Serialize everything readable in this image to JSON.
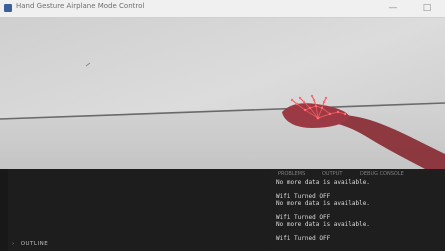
{
  "window": {
    "title": "Hand Gesture Airplane Mode Control",
    "minimize_glyph": "—",
    "maximize_glyph": "□"
  },
  "camera_feed": {
    "hand_landmark_color": "#e8555b",
    "arm_color": "#8a2f38",
    "wall_color": "#d7d7d7"
  },
  "bottom_panel": {
    "tabs": [
      "PROBLEMS",
      "OUTPUT",
      "DEBUG CONSOLE"
    ],
    "outline_label": "OUTLINE",
    "output_lines": [
      "No more data is available.",
      "",
      "Wifi Turned OFF",
      "No more data is available.",
      "",
      "Wifi Turned OFF",
      "No more data is available.",
      "",
      "Wifi Turned OFF"
    ]
  },
  "colors": {
    "panel_bg": "#1e1e1e",
    "titlebar_bg": "#f0f0f0"
  }
}
